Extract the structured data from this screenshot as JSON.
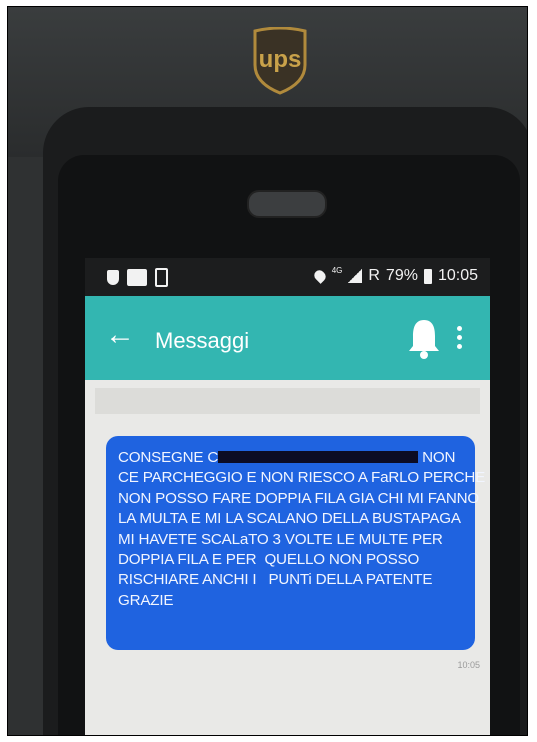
{
  "logo": {
    "text": "ups"
  },
  "statusbar": {
    "network": "4G",
    "roaming": "R",
    "battery": "79%",
    "time": "10:05",
    "icons": [
      "shield-icon",
      "cc-icon",
      "phone-icon",
      "location-icon",
      "signal-icon",
      "battery-icon"
    ]
  },
  "appbar": {
    "title": "Messaggi",
    "back_icon": "arrow-left-icon",
    "bell_icon": "bell-icon",
    "more_icon": "more-vertical-icon",
    "color": "#33b6b1"
  },
  "message": {
    "lines": [
      "CONSEGNE C",
      "NON",
      "CE PARCHEGGIO E NON RIESCO A FaRLO PERCHE",
      "NON POSSO FARE DOPPIA FILA GIA CHI MI FANNO",
      "LA MULTA E MI LA SCALANO DELLA BUSTAPAGA",
      "MI HAVETE SCALaTO 3 VOLTE LE MULTE PER",
      "DOPPIA FILA E PER  QUELLO NON POSSO",
      "RISCHIARE ANCHI I",
      "PUNTi DELLA PATENTE",
      "GRAZIE"
    ],
    "timestamp": "10:05",
    "bubble_color": "#1f63e0"
  }
}
